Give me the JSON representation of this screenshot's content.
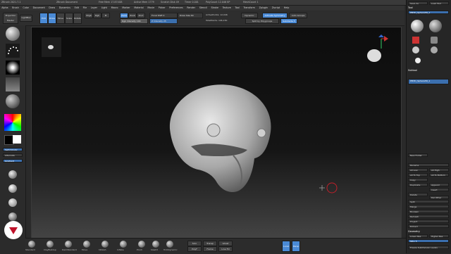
{
  "titlebar": {
    "app": "ZBrush 2021.7.1",
    "project": "ZBrush Document",
    "mem": "Free Mem 17.874GB",
    "active": "Active Mem 1779",
    "scratch": "Scratch Disk 49",
    "timer": "Timer 0.001",
    "polycount": "PolyCount 12.046 KP",
    "meshcount": "MeshCount 1"
  },
  "menu": [
    "Alpha",
    "Brush",
    "Color",
    "Document",
    "Draw",
    "Dynamics",
    "Edit",
    "File",
    "Layer",
    "Light",
    "Macro",
    "Marker",
    "Material",
    "Movie",
    "Picker",
    "Preferences",
    "Render",
    "Stencil",
    "Stroke",
    "Texture",
    "Tool",
    "Transform",
    "Zplugin",
    "Zscript",
    "Help"
  ],
  "toolbar": {
    "projection": "Projection Master",
    "lightbox": "LightBox",
    "edit": "Edit",
    "draw": "Draw",
    "move": "Move",
    "scale": "Scale",
    "rotate": "Rotate",
    "mrgb": "Mrgb",
    "rgb": "Rgb",
    "m": "M",
    "zadd": "Zadd",
    "zsub": "Zsub",
    "zcut": "Zcut",
    "focal_shift": "Focal Shift 0",
    "draw_size": "Draw Size 64",
    "rgb_intensity": "Rgb Intensity 100",
    "z_intensity": "Z Intensity 25",
    "active_points": "ActivePoints: 12,046",
    "total_points": "TotalPoints: 106,150",
    "dynamic": "Dynamic",
    "symmetry": "Activate Symmetry",
    "auto_groups": "Auto Groups",
    "split_by_polygroups": "Split by Polygroups",
    "subdivide": "Subdivide 5"
  },
  "left": {
    "color_label": "SwitchColor",
    "alternate": "Alternate",
    "gradient": "Gradient",
    "materials": [
      "MatCap Gray",
      "BasicMaterial",
      "SkinShade4",
      "Reflected Map"
    ]
  },
  "viewport": {
    "bg_top": "#0d0d0d",
    "bg_bottom": "#4a4a4a"
  },
  "right": {
    "tabs": [
      "Save As",
      "Load Tool"
    ],
    "tool_title": "Tool",
    "tool_name": "PM3D_Sphere3D_1",
    "tools": [
      "PM3D_Sphere3D_1",
      "SimpleBrush",
      "Cylinder3D",
      "PolyMesh3D",
      "Sphere3D",
      "ZSphere"
    ],
    "subtool": "Subtool",
    "subtool_item": "PM3D_Sphere3D_1",
    "actions": [
      "New Folder",
      "Rename",
      "All Low",
      "All High",
      "All To Top",
      "All To Bottom",
      "Copy",
      "Duplicate",
      "Append",
      "Insert",
      "Delete",
      "Del Other",
      "Split",
      "Merge",
      "Boolean",
      "Remesh",
      "Project",
      "Extract"
    ],
    "geometry": "Geometry",
    "lower_res": "Lower Res",
    "higher_res": "Higher Res",
    "sdiv": "SDiv 5",
    "freeze": "Freeze SubDivision Levels"
  },
  "bottom": {
    "brushes": [
      "Standard",
      "ClayBuildup",
      "DamStandard",
      "Move",
      "hPolish",
      "Inflate",
      "Pinch",
      "Slash3",
      "TrimDynamic"
    ],
    "misc": [
      "Solo",
      "Transp",
      "Ghost",
      "PolyF",
      "Frame",
      "Line Fill",
      "Local",
      "Persp"
    ]
  },
  "accent": "#4a8ad6"
}
